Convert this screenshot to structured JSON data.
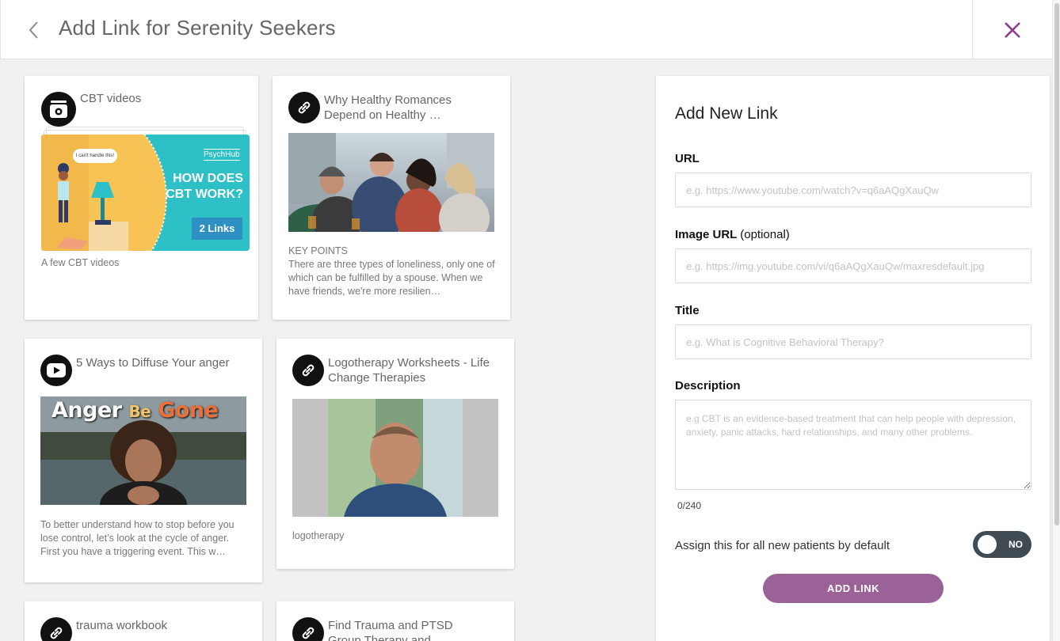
{
  "header": {
    "title": "Add Link for Serenity Seekers",
    "back_icon": "chevron-left-icon",
    "close_icon": "close-icon",
    "accent_color": "#8e3f8c"
  },
  "cards": [
    {
      "icon": "folder-collection-icon",
      "title": "CBT videos",
      "thumbnail": {
        "speech": "I can't handle this!",
        "brand": "PsychHub",
        "headline_1": "HOW DOES",
        "headline_2": "CBT WORK?",
        "badge": "2 Links"
      },
      "description": "A few CBT videos"
    },
    {
      "icon": "link-icon",
      "title": "Why Healthy Romances Depend on Healthy …",
      "description_heading": "KEY POINTS",
      "description": "There are three types of loneliness, only one of which can be fulfilled by a spouse. When we have friends, we're more resilien…"
    },
    {
      "icon": "youtube-icon",
      "title": "5 Ways to Diffuse Your anger",
      "thumbnail": {
        "word_1": "Anger",
        "word_2": "Be",
        "word_3": "Gone"
      },
      "description": "To better understand how to stop before you lose control, let’s look at the cycle of anger. First you have a triggering event. This w…"
    },
    {
      "icon": "link-icon",
      "title": "Logotherapy Worksheets - Life Change Therapies",
      "description": "logotherapy"
    },
    {
      "icon": "link-icon",
      "title": "trauma workbook"
    },
    {
      "icon": "link-icon",
      "title": "Find Trauma and PTSD Group Therapy and"
    }
  ],
  "form": {
    "heading": "Add New Link",
    "url": {
      "label": "URL",
      "placeholder": "e.g. https://www.youtube.com/watch?v=q6aAQgXauQw",
      "value": ""
    },
    "image_url": {
      "label": "Image URL",
      "optional": "(optional)",
      "placeholder": "e.g. https://img.youtube.com/vi/q6aAQgXauQw/maxresdefault.jpg",
      "value": ""
    },
    "title": {
      "label": "Title",
      "placeholder": "e.g. What is Cognitive Behavioral Therapy?",
      "value": ""
    },
    "description": {
      "label": "Description",
      "placeholder": "e.g CBT is an evidence-based treatment that can help people with depression, anxiety, panic attacks, hard relationships, and many other problems.",
      "value": ""
    },
    "char_count": "0/240",
    "assign_label": "Assign this for all new patients by default",
    "toggle_state": "NO",
    "submit_label": "ADD LINK",
    "button_color": "#9a6297"
  }
}
